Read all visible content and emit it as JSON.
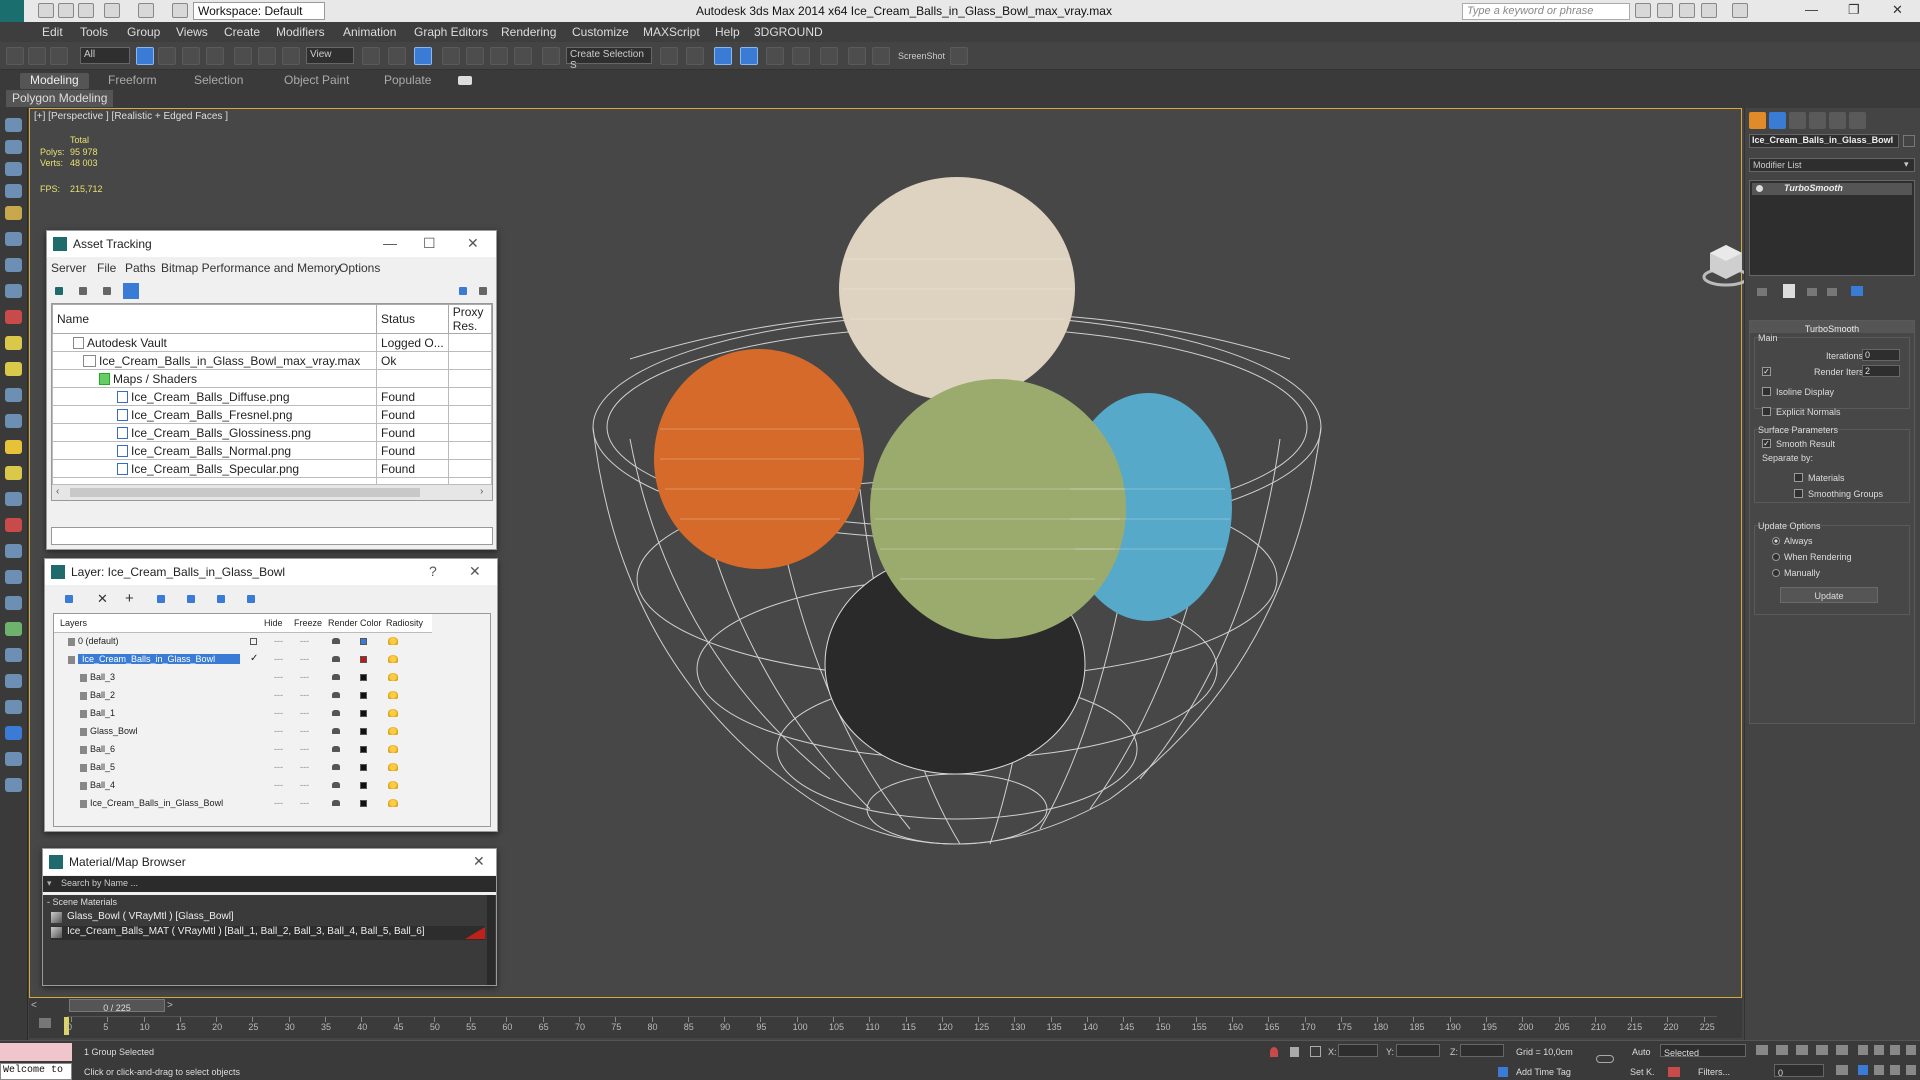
{
  "app": {
    "workspace": "Workspace: Default",
    "title": "Autodesk 3ds Max  2014 x64     Ice_Cream_Balls_in_Glass_Bowl_max_vray.max",
    "search_placeholder": "Type a keyword or phrase"
  },
  "menu": [
    "Edit",
    "Tools",
    "Group",
    "Views",
    "Create",
    "Modifiers",
    "Animation",
    "Graph Editors",
    "Rendering",
    "Customize",
    "MAXScript",
    "Help",
    "3DGROUND"
  ],
  "toolbar": {
    "filter": "All",
    "refcoord": "View",
    "selection_set": "Create Selection S",
    "screenshot": "ScreenShot"
  },
  "ribbon": {
    "tabs": [
      "Modeling",
      "Freeform",
      "Selection",
      "Object Paint",
      "Populate"
    ],
    "sub": "Polygon Modeling"
  },
  "viewport": {
    "label": "[+] [Perspective ] [Realistic + Edged Faces ]",
    "total": "Total",
    "polys_label": "Polys:",
    "polys": "95 978",
    "verts_label": "Verts:",
    "verts": "48 003",
    "fps_label": "FPS:",
    "fps": "215,712"
  },
  "asset_tracking": {
    "title": "Asset Tracking",
    "menu": [
      "Server",
      "File",
      "Paths",
      "Bitmap Performance and Memory",
      "Options"
    ],
    "columns": [
      "Name",
      "Status",
      "Proxy Res."
    ],
    "rows": [
      {
        "name": "Autodesk Vault",
        "status": "Logged O..."
      },
      {
        "name": "Ice_Cream_Balls_in_Glass_Bowl_max_vray.max",
        "status": "Ok"
      },
      {
        "name": "Maps / Shaders",
        "status": ""
      },
      {
        "name": "Ice_Cream_Balls_Diffuse.png",
        "status": "Found"
      },
      {
        "name": "Ice_Cream_Balls_Fresnel.png",
        "status": "Found"
      },
      {
        "name": "Ice_Cream_Balls_Glossiness.png",
        "status": "Found"
      },
      {
        "name": "Ice_Cream_Balls_Normal.png",
        "status": "Found"
      },
      {
        "name": "Ice_Cream_Balls_Specular.png",
        "status": "Found"
      }
    ]
  },
  "layer": {
    "title": "Layer: Ice_Cream_Balls_in_Glass_Bowl",
    "columns": [
      "Layers",
      "Hide",
      "Freeze",
      "Render",
      "Color",
      "Radiosity"
    ],
    "rows": [
      {
        "name": "0 (default)",
        "color": "#3a7bd5"
      },
      {
        "name": "Ice_Cream_Balls_in_Glass_Bowl",
        "color": "#c01818"
      },
      {
        "name": "Ball_3",
        "color": "#111111"
      },
      {
        "name": "Ball_2",
        "color": "#111111"
      },
      {
        "name": "Ball_1",
        "color": "#111111"
      },
      {
        "name": "Glass_Bowl",
        "color": "#111111"
      },
      {
        "name": "Ball_6",
        "color": "#111111"
      },
      {
        "name": "Ball_5",
        "color": "#111111"
      },
      {
        "name": "Ball_4",
        "color": "#111111"
      },
      {
        "name": "Ice_Cream_Balls_in_Glass_Bowl",
        "color": "#111111"
      }
    ]
  },
  "material_browser": {
    "title": "Material/Map Browser",
    "search": "Search by Name ...",
    "section": "- Scene Materials",
    "items": [
      "Glass_Bowl  ( VRayMtl ) [Glass_Bowl]",
      "Ice_Cream_Balls_MAT  ( VRayMtl ) [Ball_1, Ball_2, Ball_3, Ball_4, Ball_5, Ball_6]"
    ]
  },
  "command_panel": {
    "object_name": "Ice_Cream_Balls_in_Glass_Bowl",
    "modifier_list": "Modifier List",
    "stack_item": "TurboSmooth",
    "rollout_title": "TurboSmooth",
    "main": "Main",
    "iterations_label": "Iterations:",
    "iterations": "0",
    "render_iters_label": "Render Iters:",
    "render_iters": "2",
    "isoline": "Isoline Display",
    "explicit": "Explicit Normals",
    "surface": "Surface Parameters",
    "smooth_result": "Smooth Result",
    "separate": "Separate by:",
    "materials": "Materials",
    "smoothing": "Smoothing Groups",
    "update_options": "Update Options",
    "always": "Always",
    "when_rendering": "When Rendering",
    "manually": "Manually",
    "update_btn": "Update"
  },
  "timeline": {
    "frame": "0 / 225",
    "ticks": [
      "0",
      "5",
      "10",
      "15",
      "20",
      "25",
      "30",
      "35",
      "40",
      "45",
      "50",
      "55",
      "60",
      "65",
      "70",
      "75",
      "80",
      "85",
      "90",
      "95",
      "100",
      "105",
      "110",
      "115",
      "120",
      "125",
      "130",
      "135",
      "140",
      "145",
      "150",
      "155",
      "160",
      "165",
      "170",
      "175",
      "180",
      "185",
      "190",
      "195",
      "200",
      "205",
      "210",
      "215",
      "220",
      "225"
    ]
  },
  "status": {
    "welcome": "Welcome to",
    "selected": "1 Group Selected",
    "hint": "Click or click-and-drag to select objects",
    "x": "X:",
    "y": "Y:",
    "z": "Z:",
    "grid": "Grid = 10,0cm",
    "add_time_tag": "Add Time Tag",
    "auto": "Auto",
    "set_k": "Set K.",
    "key_mode": "Selected",
    "filters": "Filters...",
    "frame_field": "0"
  }
}
